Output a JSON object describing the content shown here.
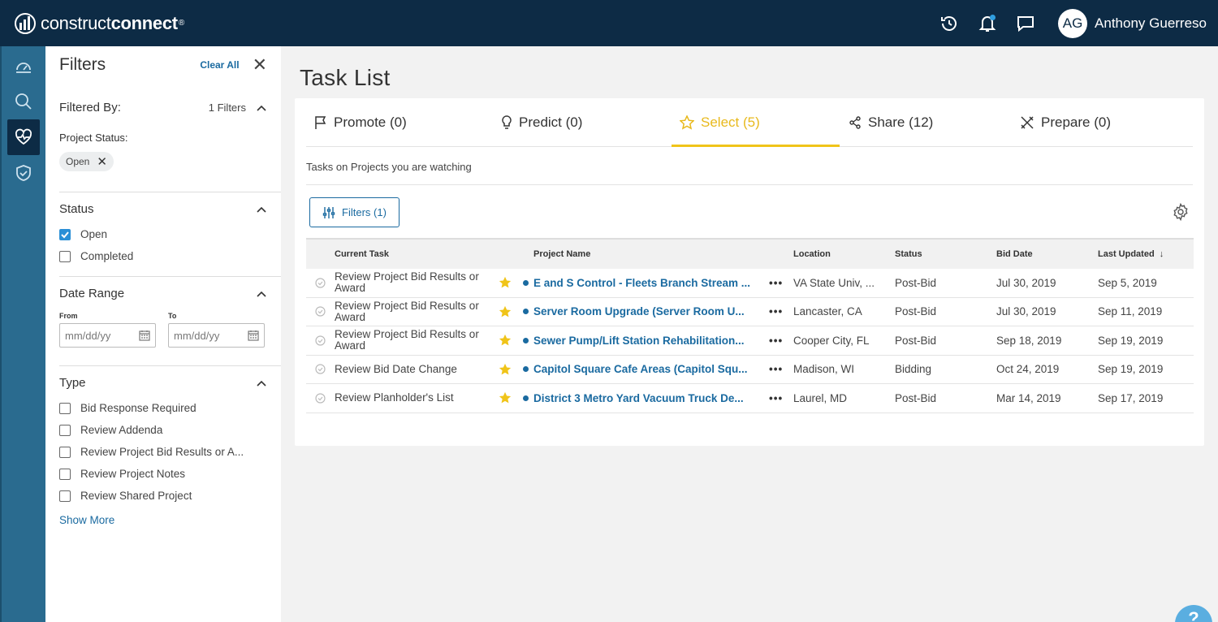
{
  "brand": {
    "light": "construct",
    "bold": "connect",
    "mark": "®"
  },
  "user": {
    "initials": "AG",
    "name": "Anthony Guerreso"
  },
  "colors": {
    "topbar": "#0d2b45",
    "rail": "#2a6b8f",
    "link": "#1a6aa0",
    "accent": "#f0c419"
  },
  "filters": {
    "title": "Filters",
    "clear_all": "Clear All",
    "filtered_by": "Filtered By:",
    "count": "1 Filters",
    "project_status_label": "Project Status:",
    "active_pill": "Open",
    "status": {
      "title": "Status",
      "options": [
        {
          "label": "Open",
          "checked": true
        },
        {
          "label": "Completed",
          "checked": false
        }
      ]
    },
    "date_range": {
      "title": "Date Range",
      "from_label": "From",
      "to_label": "To",
      "from_placeholder": "mm/dd/yy",
      "to_placeholder": "mm/dd/yy"
    },
    "type": {
      "title": "Type",
      "options": [
        {
          "label": "Bid Response Required",
          "checked": false
        },
        {
          "label": "Review Addenda",
          "checked": false
        },
        {
          "label": "Review Project Bid Results or A...",
          "checked": false
        },
        {
          "label": "Review Project Notes",
          "checked": false
        },
        {
          "label": "Review Shared Project",
          "checked": false
        }
      ]
    },
    "show_more": "Show More"
  },
  "main": {
    "title": "Task List",
    "tabs": [
      {
        "label": "Promote (0)",
        "icon": "flag-icon",
        "active": false
      },
      {
        "label": "Predict (0)",
        "icon": "lightbulb-icon",
        "active": false
      },
      {
        "label": "Select (5)",
        "icon": "star-icon",
        "active": true
      },
      {
        "label": "Share (12)",
        "icon": "share-icon",
        "active": false
      },
      {
        "label": "Prepare (0)",
        "icon": "tools-icon",
        "active": false
      }
    ],
    "subtitle": "Tasks on Projects you are watching",
    "filter_button": "Filters (1)",
    "columns": {
      "task": "Current Task",
      "project": "Project Name",
      "location": "Location",
      "status": "Status",
      "bid_date": "Bid Date",
      "last_updated": "Last Updated"
    },
    "rows": [
      {
        "task": "Review Project Bid Results or Award",
        "project": "E and S Control - Fleets Branch Stream ...",
        "location": "VA State Univ, ...",
        "status": "Post-Bid",
        "bid_date": "Jul 30, 2019",
        "updated": "Sep 5, 2019"
      },
      {
        "task": "Review Project Bid Results or Award",
        "project": "Server Room Upgrade (Server Room U...",
        "location": "Lancaster, CA",
        "status": "Post-Bid",
        "bid_date": "Jul 30, 2019",
        "updated": "Sep 11, 2019"
      },
      {
        "task": "Review Project Bid Results or Award",
        "project": "Sewer Pump/Lift Station Rehabilitation...",
        "location": "Cooper City, FL",
        "status": "Post-Bid",
        "bid_date": "Sep 18, 2019",
        "updated": "Sep 19, 2019"
      },
      {
        "task": "Review Bid Date Change",
        "project": "Capitol Square Cafe Areas (Capitol Squ...",
        "location": "Madison, WI",
        "status": "Bidding",
        "bid_date": "Oct 24, 2019",
        "updated": "Sep 19, 2019"
      },
      {
        "task": "Review Planholder's List",
        "project": "District 3 Metro Yard Vacuum Truck De...",
        "location": "Laurel, MD",
        "status": "Post-Bid",
        "bid_date": "Mar 14, 2019",
        "updated": "Sep 17, 2019"
      }
    ],
    "more_glyph": "•••"
  },
  "help": {
    "label": "?"
  }
}
